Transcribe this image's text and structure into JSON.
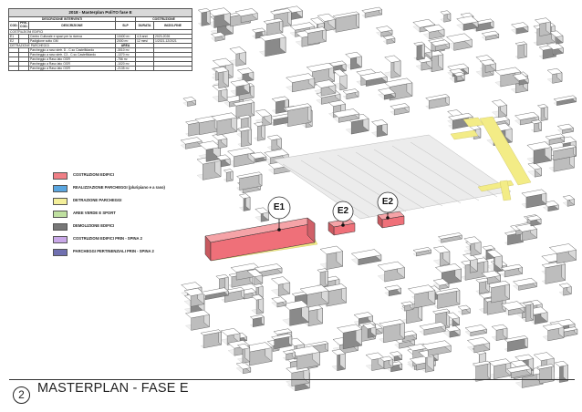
{
  "table": {
    "title": "2018 - Masterplan PoliTO fase E",
    "hdr_descr_interventi": "DESCRIZIONE INTERVENTI",
    "hdr_costruzione": "COSTRUZIONE",
    "col_cod": "COD.",
    "col_precod": "PRE-\nCOD.",
    "col_descrizione": "DESCRIZIONE",
    "col_slp": "SLP",
    "col_durata": "DURATA",
    "col_inizio_fine": "INIZIO-FINE",
    "sec_costruzioni": "COSTRUZIONI EDIFICI",
    "rows_costruzioni": [
      {
        "cod": "E1",
        "precod": "",
        "descr": "Centro Culturale e spazi per la ricerca",
        "slp": "10400 m²",
        "durata": "4,5 anni",
        "periodo": "2023-2026"
      },
      {
        "cod": "E2",
        "precod": "",
        "descr": "Padiglione sotto GM",
        "slp": "2000 m²",
        "durata": "12 mesi",
        "periodo": "1/2021-12/2021"
      }
    ],
    "sec_detrazione": "DETRAZIONE PARCHEGGI",
    "hdr_area": "AREA",
    "rows_detrazione": [
      {
        "descr": "Parcheggio a raso stetr. D - C.so Castelfidardo",
        "area": "-3010 m²"
      },
      {
        "descr": "Parcheggio a raso stetr. C3 - C.so Castelfidardo",
        "area": "-1370 m²"
      },
      {
        "descr": "Parcheggio a Raso lato OGR",
        "area": "-756 m²"
      },
      {
        "descr": "Parcheggio a Raso lato OGR",
        "area": "-1020 m²"
      },
      {
        "descr": "Parcheggio a Raso lato OGR",
        "area": "-2135 m²"
      }
    ]
  },
  "legend": [
    {
      "label": "COSTRUZIONI EDIFICI",
      "color": "#f07f86"
    },
    {
      "label": "REALIZZAZIONE PARCHEGGI (pluripiano e a raso)",
      "color": "#5aa6e0"
    },
    {
      "label": "DETRAZIONE PARCHEGGI",
      "color": "#f4ef9a"
    },
    {
      "label": "AREE VERDE E SPORT",
      "color": "#bfe0a0"
    },
    {
      "label": "DEMOLIZIONE EDIFICI",
      "color": "#777777"
    },
    {
      "label": "COSTRUZIONI EDIFICI PRIN - SPINA 2",
      "color": "#c9a8e8"
    },
    {
      "label": "PARCHEGGI PERTINENZIALI PRIN - SPINA 2",
      "color": "#7070b0"
    }
  ],
  "map_labels": {
    "e1": "E1",
    "e2a": "E2",
    "e2b": "E2"
  },
  "footer": {
    "page_number": "2",
    "title": "MASTERPLAN - FASE E"
  }
}
